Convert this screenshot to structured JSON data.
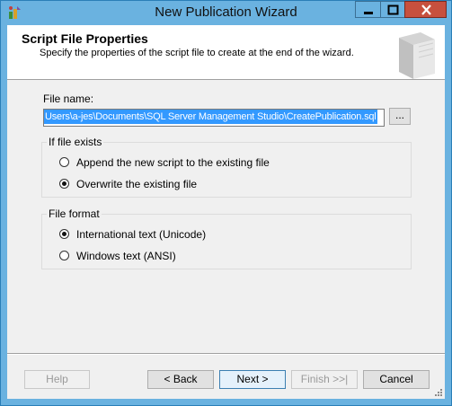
{
  "window": {
    "title": "New Publication Wizard"
  },
  "header": {
    "title": "Script File Properties",
    "subtitle": "Specify the properties of the script file to create at the end of the wizard."
  },
  "file": {
    "label": "File name:",
    "value": "Users\\a-jes\\Documents\\SQL Server Management Studio\\CreatePublication.sql",
    "browse_label": "..."
  },
  "if_exists": {
    "legend": "If file exists",
    "options": [
      {
        "label": "Append the new script to the existing file",
        "selected": false
      },
      {
        "label": "Overwrite the existing file",
        "selected": true
      }
    ]
  },
  "file_format": {
    "legend": "File format",
    "options": [
      {
        "label": "International text (Unicode)",
        "selected": true
      },
      {
        "label": "Windows text (ANSI)",
        "selected": false
      }
    ]
  },
  "buttons": {
    "help": "Help",
    "back": "< Back",
    "next": "Next >",
    "finish": "Finish >>|",
    "cancel": "Cancel"
  },
  "colors": {
    "titlebar": "#6ab2e0",
    "close": "#c7503e",
    "selection": "#3399ff"
  }
}
